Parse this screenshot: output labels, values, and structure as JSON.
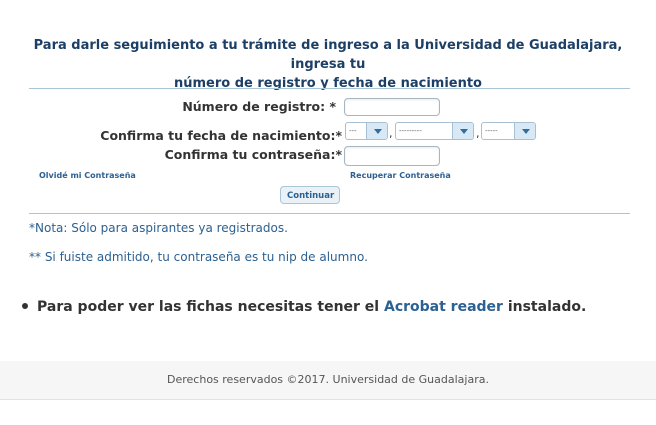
{
  "intro": {
    "line1": "Para darle seguimiento a tu trámite de ingreso a la Universidad de Guadalajara, ingresa tu",
    "line2": "número de registro y fecha de nacimiento"
  },
  "form": {
    "registro_label": "Número de registro: *",
    "fecha_label": "Confirma tu fecha de nacimiento:*",
    "fecha_day_value": "---",
    "fecha_month_value": "---------",
    "fecha_year_value": "-----",
    "separator": ",",
    "password_label": "Confirma tu contraseña:*",
    "forgot_link": "Olvidé mi Contraseña",
    "recover_link": "Recuperar Contraseña",
    "submit_label": "Continuar"
  },
  "notes": {
    "note1": "*Nota: Sólo para aspirantes ya registrados.",
    "note2": "** Si fuiste admitido, tu contraseña es tu nip de alumno."
  },
  "acrobat": {
    "prefix": "Para poder ver las fichas necesitas tener el",
    "link": "Acrobat reader",
    "suffix": "instalado."
  },
  "footer": {
    "text": "Derechos reservados ©2017. Universidad de Guadalajara."
  }
}
